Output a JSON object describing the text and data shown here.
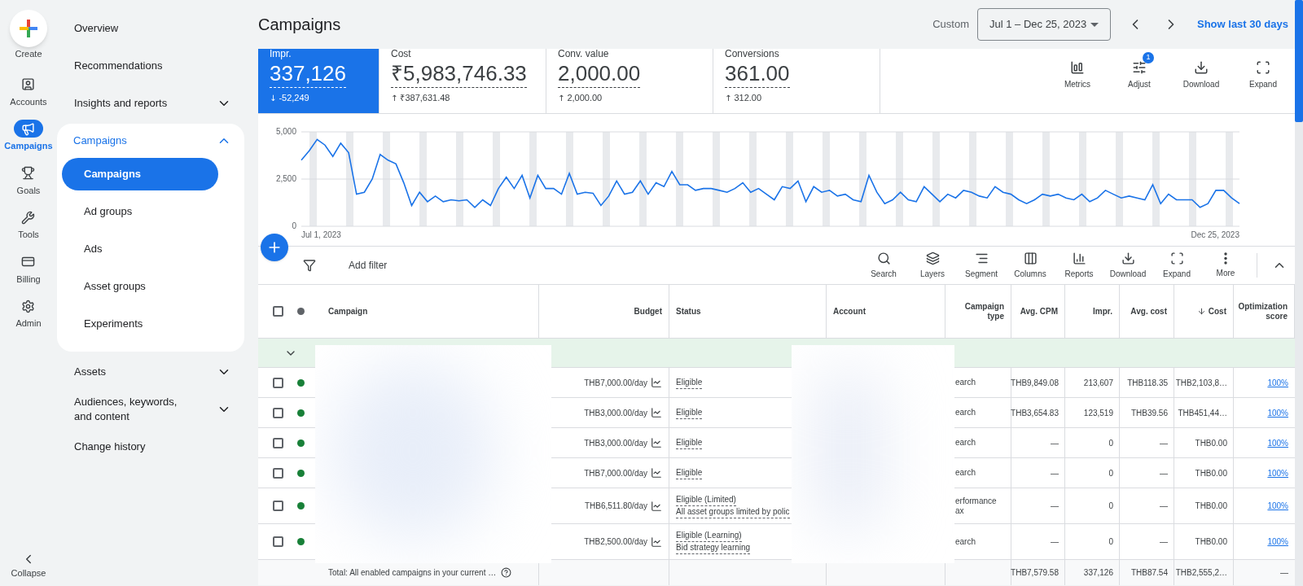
{
  "rail": {
    "create": "Create",
    "items": [
      {
        "label": "Accounts",
        "selected": false
      },
      {
        "label": "Campaigns",
        "selected": true
      },
      {
        "label": "Goals",
        "selected": false
      },
      {
        "label": "Tools",
        "selected": false
      },
      {
        "label": "Billing",
        "selected": false
      },
      {
        "label": "Admin",
        "selected": false
      }
    ],
    "collapse": "Collapse"
  },
  "nav": [
    {
      "kind": "item",
      "label": "Overview"
    },
    {
      "kind": "item",
      "label": "Recommendations"
    },
    {
      "kind": "section",
      "label": "Insights and reports",
      "expanded": false
    },
    {
      "kind": "section",
      "label": "Campaigns",
      "expanded": true,
      "children": [
        {
          "label": "Campaigns",
          "selected": true
        },
        {
          "label": "Ad groups",
          "selected": false
        },
        {
          "label": "Ads",
          "selected": false
        },
        {
          "label": "Asset groups",
          "selected": false
        },
        {
          "label": "Experiments",
          "selected": false
        }
      ]
    },
    {
      "kind": "section",
      "label": "Assets",
      "expanded": false
    },
    {
      "kind": "section",
      "label": "Audiences, keywords, and content",
      "expanded": false
    },
    {
      "kind": "item",
      "label": "Change history"
    }
  ],
  "page_title": "Campaigns",
  "date": {
    "label": "Custom",
    "range": "Jul 1 – Dec 25, 2023",
    "shortcut": "Show last 30 days"
  },
  "metrics": [
    {
      "label": "Impr.",
      "value": "337,126",
      "delta": "-52,249",
      "arrow": "↓",
      "selected": true
    },
    {
      "label": "Cost",
      "value": "₹5,983,746.33",
      "delta": "₹387,631.48",
      "arrow": "↑",
      "selected": false
    },
    {
      "label": "Conv. value",
      "value": "2,000.00",
      "delta": "2,000.00",
      "arrow": "↑",
      "selected": false
    },
    {
      "label": "Conversions",
      "value": "361.00",
      "delta": "312.00",
      "arrow": "↑",
      "selected": false
    }
  ],
  "chart_actions": [
    {
      "label": "Metrics"
    },
    {
      "label": "Adjust",
      "badge": "1"
    },
    {
      "label": "Download"
    },
    {
      "label": "Expand"
    }
  ],
  "chart_range": {
    "start": "Jul 1, 2023",
    "end": "Dec 25, 2023"
  },
  "chart_data": {
    "type": "line",
    "yticks": [
      {
        "value": 0,
        "label": "0"
      },
      {
        "value": 2500,
        "label": "2,500"
      },
      {
        "value": 5000,
        "label": "5,000"
      }
    ],
    "ylim": [
      0,
      5000
    ],
    "series": [
      {
        "color": "#1a73e8",
        "values": [
          3500,
          4000,
          4600,
          4300,
          3700,
          4400,
          3900,
          1700,
          1800,
          2500,
          3800,
          3500,
          3300,
          2300,
          1100,
          1800,
          1300,
          1600,
          1300,
          1400,
          1350,
          1400,
          1000,
          1400,
          1100,
          2000,
          2600,
          2000,
          2700,
          1500,
          2700,
          2000,
          2000,
          1700,
          2800,
          1700,
          1800,
          1750,
          1100,
          1600,
          2400,
          1700,
          1800,
          2400,
          1700,
          2300,
          2100,
          2900,
          2200,
          2200,
          1900,
          2000,
          2000,
          1900,
          1800,
          2000,
          2300,
          1800,
          2000,
          1700,
          1400,
          2100,
          2000,
          2400,
          1300,
          2100,
          1800,
          1900,
          1600,
          1700,
          1400,
          1300,
          2700,
          1800,
          1200,
          1400,
          1800,
          1400,
          1300,
          2100,
          1700,
          1300,
          1700,
          1500,
          1900,
          1800,
          1600,
          1500,
          2100,
          1800,
          1700,
          1400,
          1200,
          1400,
          1700,
          1600,
          1700,
          1500,
          1400,
          1700,
          1300,
          1500,
          1900,
          1700,
          1500,
          1600,
          1500,
          1400,
          2200,
          1200,
          1700,
          1400,
          1400,
          1400,
          1000,
          1200,
          1900,
          1900,
          1500,
          1200
        ]
      }
    ]
  },
  "toolbar": {
    "filter": "Add filter",
    "actions": [
      {
        "label": "Search"
      },
      {
        "label": "Layers"
      },
      {
        "label": "Segment"
      },
      {
        "label": "Columns"
      },
      {
        "label": "Reports"
      },
      {
        "label": "Download"
      },
      {
        "label": "Expand"
      },
      {
        "label": "More"
      }
    ]
  },
  "table": {
    "select_all": {
      "checked": false
    },
    "columns": [
      {
        "label": "Campaign",
        "sorted": false
      },
      {
        "label": "Budget",
        "sorted": false
      },
      {
        "label": "Status",
        "sorted": false
      },
      {
        "label": "Account",
        "sorted": false
      },
      {
        "label": "Campaign type",
        "sorted": false
      },
      {
        "label": "Avg. CPM",
        "sorted": false
      },
      {
        "label": "Impr.",
        "sorted": false
      },
      {
        "label": "Avg. cost",
        "sorted": false
      },
      {
        "label": "Cost",
        "sorted": true
      },
      {
        "label": "Optimization score",
        "sorted": false
      }
    ],
    "group": {
      "expanded": true
    },
    "rows": [
      {
        "checked": false,
        "color": "#188038",
        "budget": "THB7,000.00/day",
        "status": [
          "Eligible"
        ],
        "type": "earch",
        "cpm": "THB9,849.08",
        "impr": "213,607",
        "avg_cost": "THB118.35",
        "cost": "THB2,103,8…",
        "score": "100%"
      },
      {
        "checked": false,
        "color": "#188038",
        "budget": "THB3,000.00/day",
        "status": [
          "Eligible"
        ],
        "type": "earch",
        "cpm": "THB3,654.83",
        "impr": "123,519",
        "avg_cost": "THB39.56",
        "cost": "THB451,44…",
        "score": "100%"
      },
      {
        "checked": false,
        "color": "#188038",
        "budget": "THB3,000.00/day",
        "status": [
          "Eligible"
        ],
        "type": "earch",
        "cpm": "—",
        "impr": "0",
        "avg_cost": "—",
        "cost": "THB0.00",
        "score": "100%"
      },
      {
        "checked": false,
        "color": "#188038",
        "budget": "THB7,000.00/day",
        "status": [
          "Eligible"
        ],
        "type": "earch",
        "cpm": "—",
        "impr": "0",
        "avg_cost": "—",
        "cost": "THB0.00",
        "score": "100%"
      },
      {
        "checked": false,
        "color": "#188038",
        "budget": "THB6,511.80/day",
        "status": [
          "Eligible (Limited)",
          "All asset groups limited by polic"
        ],
        "type": "erformance ax",
        "cpm": "—",
        "impr": "0",
        "avg_cost": "—",
        "cost": "THB0.00",
        "score": "100%"
      },
      {
        "checked": false,
        "color": "#188038",
        "budget": "THB2,500.00/day",
        "status": [
          "Eligible (Learning)",
          "Bid strategy learning"
        ],
        "type": "earch",
        "cpm": "—",
        "impr": "0",
        "avg_cost": "—",
        "cost": "THB0.00",
        "score": "100%"
      }
    ],
    "total": {
      "label": "Total: All enabled campaigns in your current …",
      "cpm": "THB7,579.58",
      "impr": "337,126",
      "avg_cost": "THB87.54",
      "cost": "THB2,555,2…",
      "score": "—"
    }
  }
}
